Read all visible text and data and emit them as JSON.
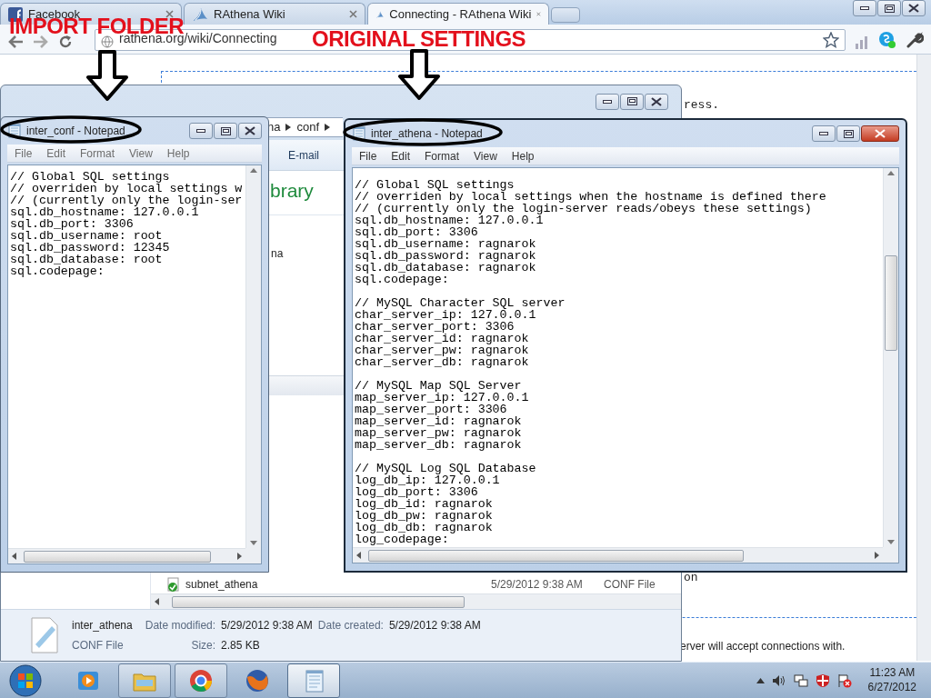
{
  "browser": {
    "tabs": [
      {
        "title": "Facebook",
        "kind": "square-logo",
        "selected": false
      },
      {
        "title": "RAthena Wiki",
        "kind": "wing",
        "selected": false
      },
      {
        "title": "Connecting - RAthena Wiki",
        "kind": "wing",
        "selected": true
      }
    ],
    "address": "rathena.org/wiki/Connecting",
    "page_fragments": [
      "ress.",
      "on",
      "erver will accept connections with."
    ]
  },
  "explorer": {
    "breadcrumb": [
      "na",
      "conf"
    ],
    "toolbar": [
      "E-mail"
    ],
    "heading": "brary",
    "list_item": "na",
    "files": [
      {
        "name": "subnet_athena",
        "date": "5/29/2012 9:38 AM",
        "type": "CONF File"
      }
    ],
    "details": {
      "name": "inter_athena",
      "type": "CONF File",
      "fields": [
        {
          "label": "Date modified:",
          "value": "5/29/2012 9:38 AM"
        },
        {
          "label": "Date created:",
          "value": "5/29/2012 9:38 AM"
        },
        {
          "label": "Size:",
          "value": "2.85 KB"
        }
      ]
    }
  },
  "notepads": [
    {
      "title": "inter_conf - Notepad",
      "active": false,
      "menu": [
        "File",
        "Edit",
        "Format",
        "View",
        "Help"
      ],
      "blocks": [
        [
          "// Global SQL settings",
          "// overriden by local settings w",
          "// (currently only the login-ser",
          "sql.db_hostname: 127.0.0.1",
          "sql.db_port: 3306",
          "sql.db_username: root",
          "sql.db_password: 12345",
          "sql.db_database: root",
          "sql.codepage:"
        ]
      ]
    },
    {
      "title": "inter_athena - Notepad",
      "active": true,
      "menu": [
        "File",
        "Edit",
        "Format",
        "View",
        "Help"
      ],
      "blocks": [
        [
          "// Global SQL settings",
          "// overriden by local settings when the hostname is defined there",
          "// (currently only the login-server reads/obeys these settings)",
          "sql.db_hostname: 127.0.0.1",
          "sql.db_port: 3306",
          "sql.db_username: ragnarok",
          "sql.db_password: ragnarok",
          "sql.db_database: ragnarok",
          "sql.codepage:"
        ],
        [
          "// MySQL Character SQL server",
          "char_server_ip: 127.0.0.1",
          "char_server_port: 3306",
          "char_server_id: ragnarok",
          "char_server_pw: ragnarok",
          "char_server_db: ragnarok"
        ],
        [
          "// MySQL Map SQL Server",
          "map_server_ip: 127.0.0.1",
          "map_server_port: 3306",
          "map_server_id: ragnarok",
          "map_server_pw: ragnarok",
          "map_server_db: ragnarok"
        ],
        [
          "// MySQL Log SQL Database",
          "log_db_ip: 127.0.0.1",
          "log_db_port: 3306",
          "log_db_id: ragnarok",
          "log_db_pw: ragnarok",
          "log_db_db: ragnarok",
          "log_codepage:"
        ]
      ]
    }
  ],
  "taskbar": {
    "apps": [
      {
        "kind": "media",
        "open": false,
        "selected": false
      },
      {
        "kind": "folder",
        "open": true,
        "selected": false
      },
      {
        "kind": "chrome",
        "open": true,
        "selected": false
      },
      {
        "kind": "firefox",
        "open": false,
        "selected": false
      },
      {
        "kind": "notepad",
        "open": true,
        "selected": true
      }
    ],
    "clock": {
      "time": "11:23 AM",
      "date": "6/27/2012"
    }
  },
  "annotations": [
    {
      "text": "IMPORT FOLDER"
    },
    {
      "text": "ORIGINAL SETTINGS"
    }
  ]
}
